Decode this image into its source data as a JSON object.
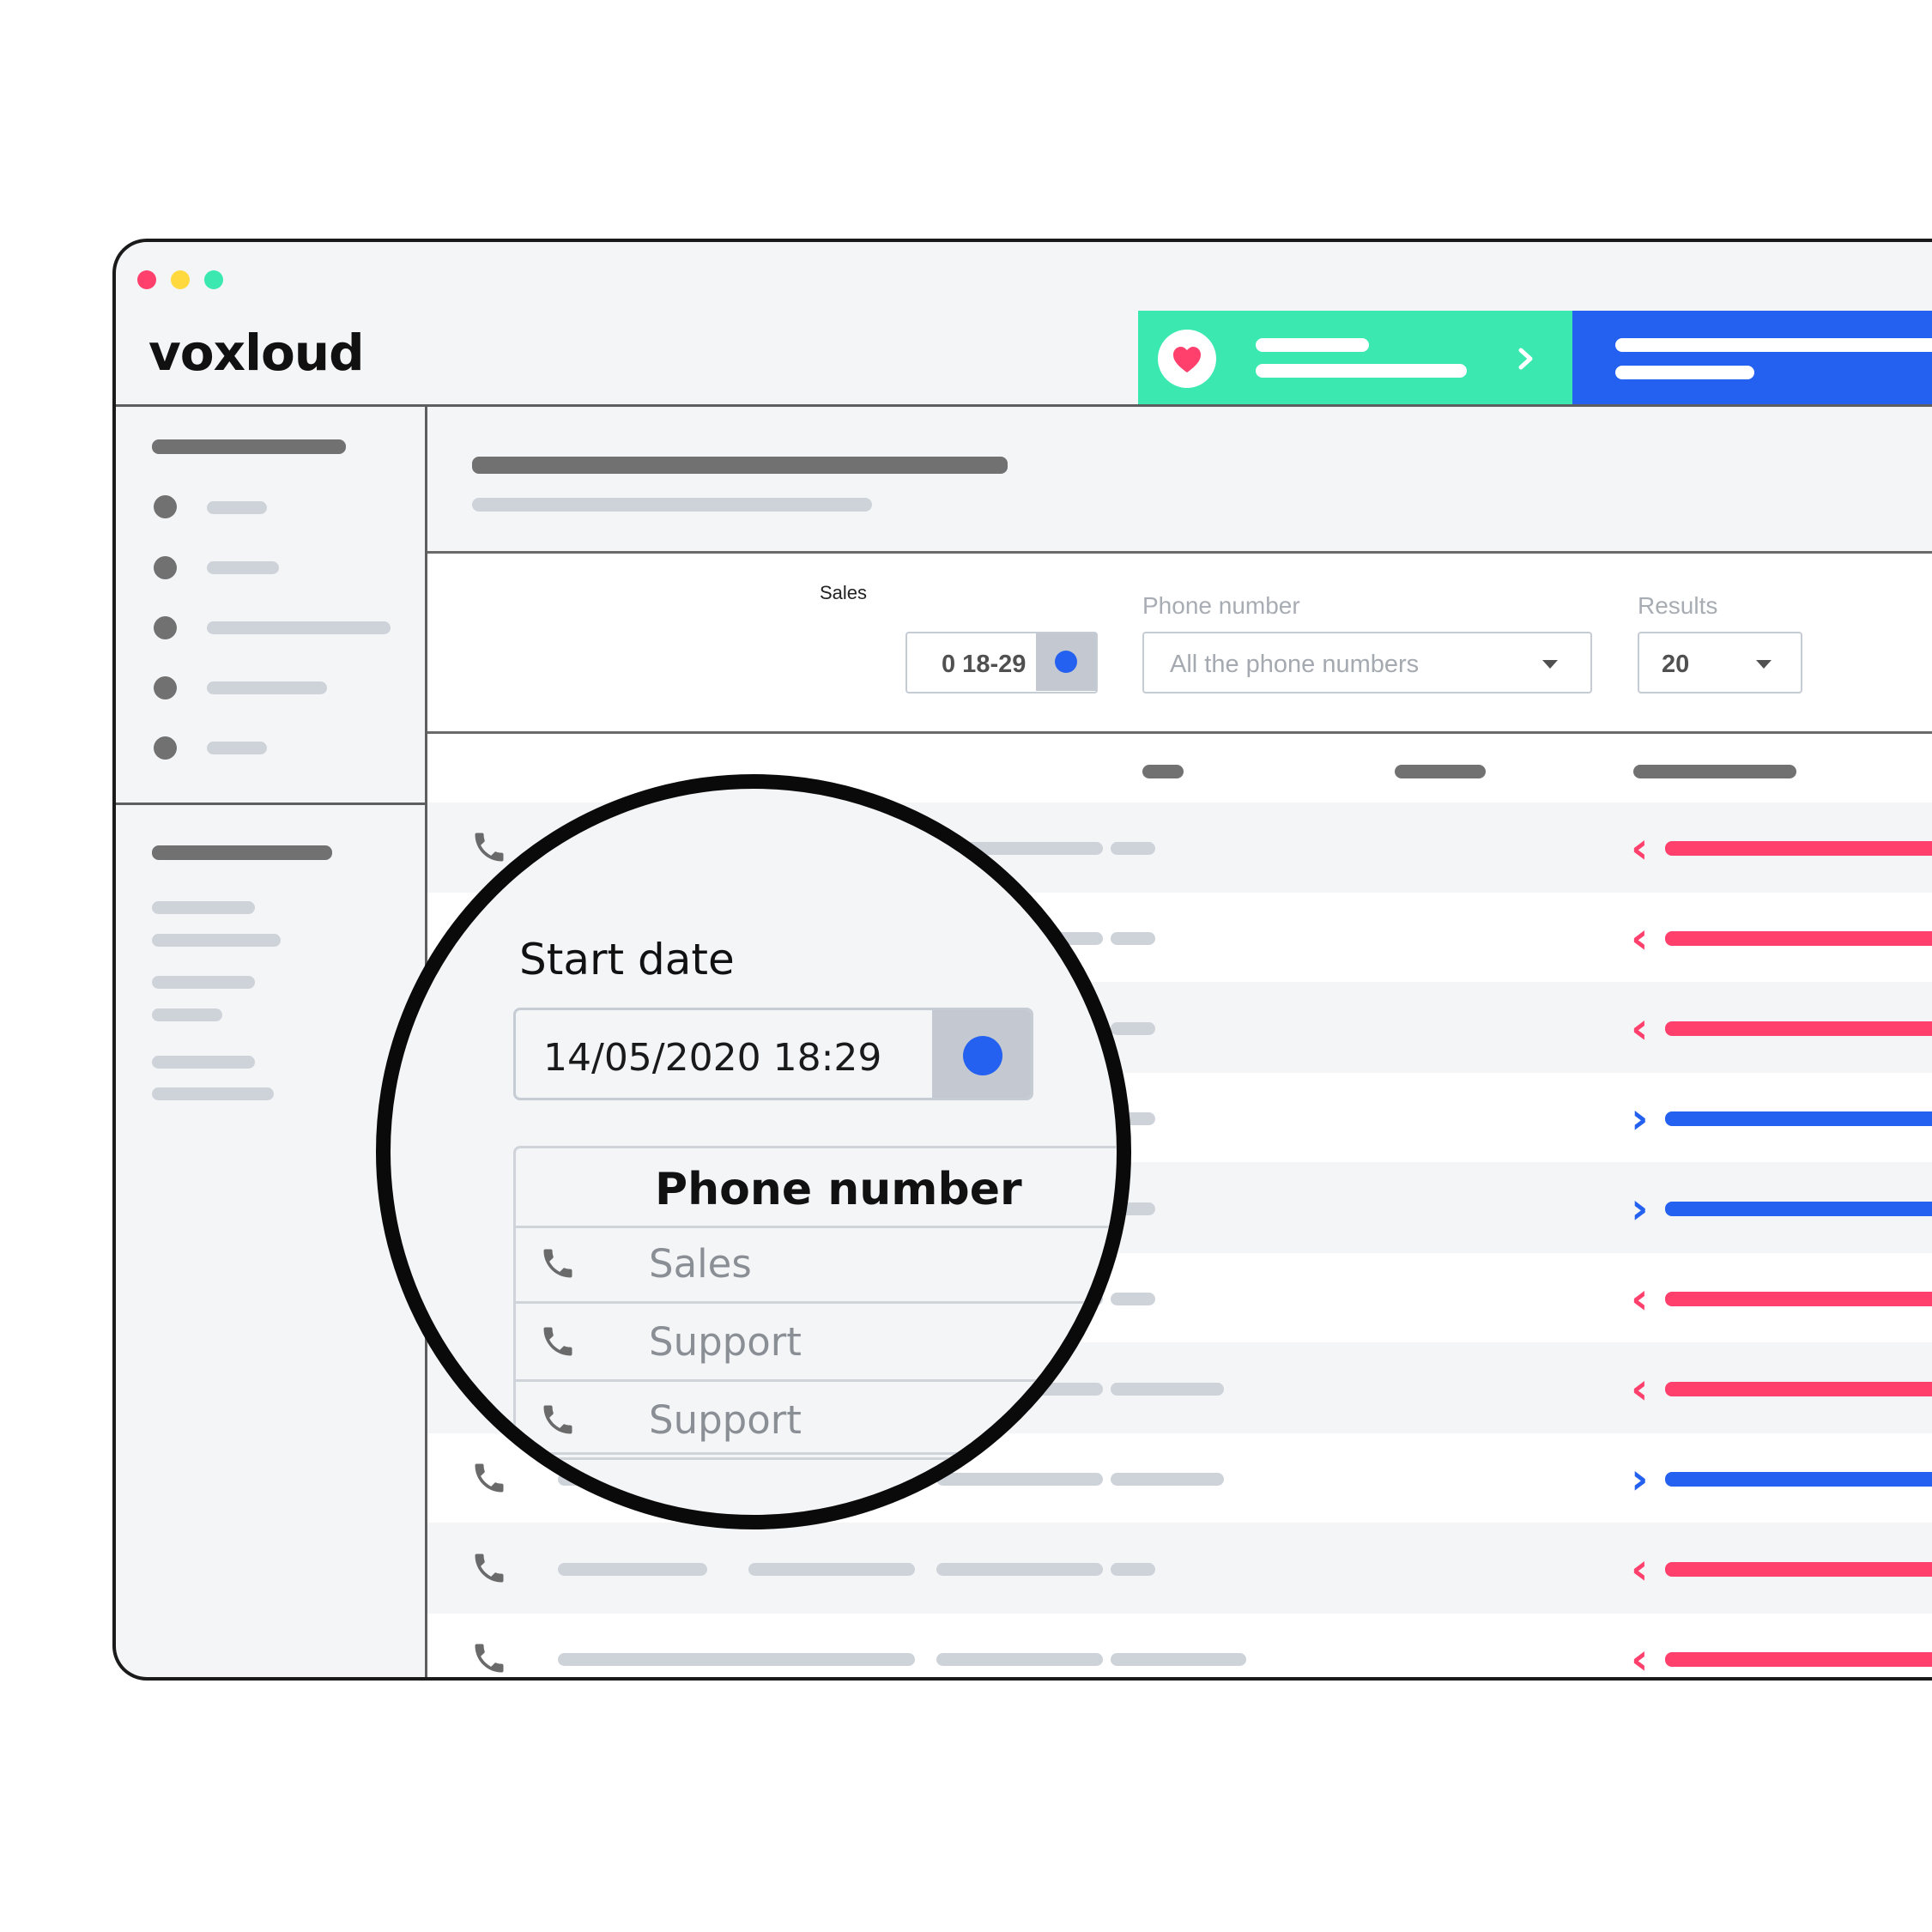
{
  "app": {
    "logo": "voxloud"
  },
  "colors": {
    "banner_green": "#3ae8b0",
    "banner_blue": "#2461f0",
    "incoming": "#ff3f6c",
    "outgoing": "#2461f0",
    "accent_dot": "#2461f0"
  },
  "filters": {
    "phone_number": {
      "label": "Phone number",
      "value": "All the phone numbers"
    },
    "results": {
      "label": "Results",
      "value": "20"
    },
    "start_date_partial": "0 18-29",
    "stray_text": "Sales"
  },
  "magnifier": {
    "start_date_label": "Start date",
    "start_date_value": "14/05/2020 18:29",
    "phone_header": "Phone number",
    "phone_rows": [
      {
        "label": "Sales",
        "icon": "phone-icon"
      },
      {
        "label": "Support",
        "icon": "phone-icon"
      },
      {
        "label": "Support",
        "icon": "phone-icon"
      }
    ]
  },
  "table_rows": [
    {
      "direction": "incoming"
    },
    {
      "direction": "incoming"
    },
    {
      "direction": "incoming"
    },
    {
      "direction": "outgoing"
    },
    {
      "direction": "outgoing"
    },
    {
      "direction": "incoming"
    },
    {
      "direction": "incoming"
    },
    {
      "direction": "outgoing"
    },
    {
      "direction": "incoming"
    },
    {
      "direction": "incoming"
    }
  ]
}
